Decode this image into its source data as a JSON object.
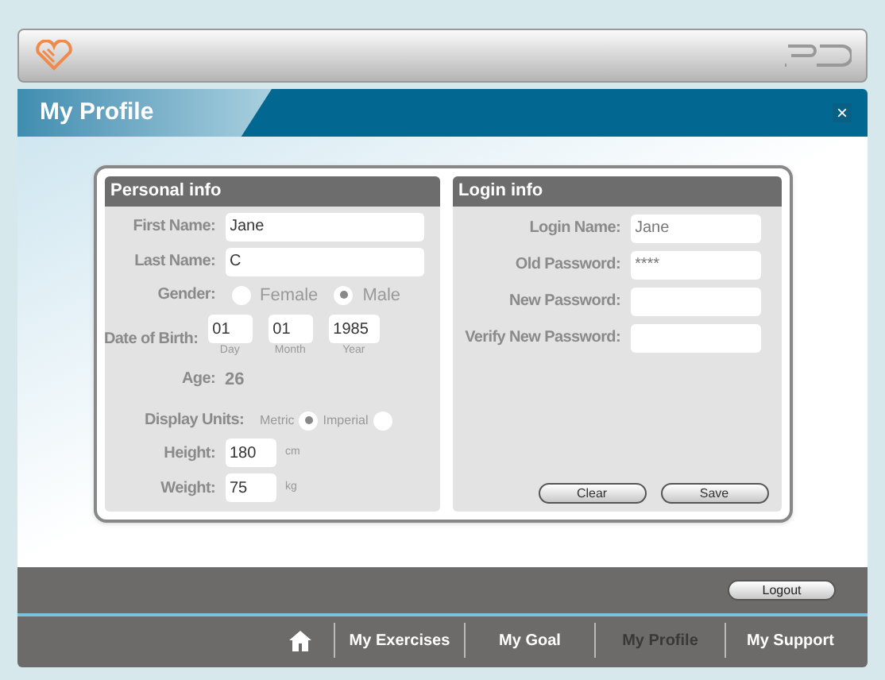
{
  "window": {
    "title": "My Profile",
    "close": "×"
  },
  "personal_info": {
    "heading": "Personal info",
    "first_name": {
      "label": "First Name:",
      "value": "Jane"
    },
    "last_name": {
      "label": "Last Name:",
      "value": "C"
    },
    "gender": {
      "label": "Gender:",
      "options": [
        {
          "label": "Female",
          "selected": false
        },
        {
          "label": "Male",
          "selected": true
        }
      ]
    },
    "date_of_birth": {
      "label": "Date of Birth:",
      "parts": [
        {
          "value": "01",
          "caption": "Day"
        },
        {
          "value": "01",
          "caption": "Month"
        },
        {
          "value": "1985",
          "caption": "Year"
        }
      ]
    },
    "age": {
      "label": "Age:",
      "value": "26"
    },
    "display_units": {
      "label": "Display Units:",
      "options": [
        {
          "label": "Metric",
          "selected": true
        },
        {
          "label": "Imperial",
          "selected": false
        }
      ]
    },
    "height": {
      "label": "Height:",
      "value": "180",
      "unit": "cm"
    },
    "weight": {
      "label": "Weight:",
      "value": "75",
      "unit": "kg"
    }
  },
  "login_info": {
    "heading": "Login info",
    "fields": [
      {
        "label": "Login Name:",
        "value": "Jane"
      },
      {
        "label": "Old Password:",
        "value": "****"
      },
      {
        "label": "New Password:"
      },
      {
        "label": "Verify New Password:"
      }
    ],
    "buttons": [
      "Clear",
      "Save"
    ]
  },
  "logout": "Logout",
  "nav": [
    {
      "label": "My Exercises",
      "selected": false
    },
    {
      "label": "My Goal",
      "selected": false
    },
    {
      "label": "My Profile",
      "selected": true
    },
    {
      "label": "My Support",
      "selected": false
    }
  ]
}
